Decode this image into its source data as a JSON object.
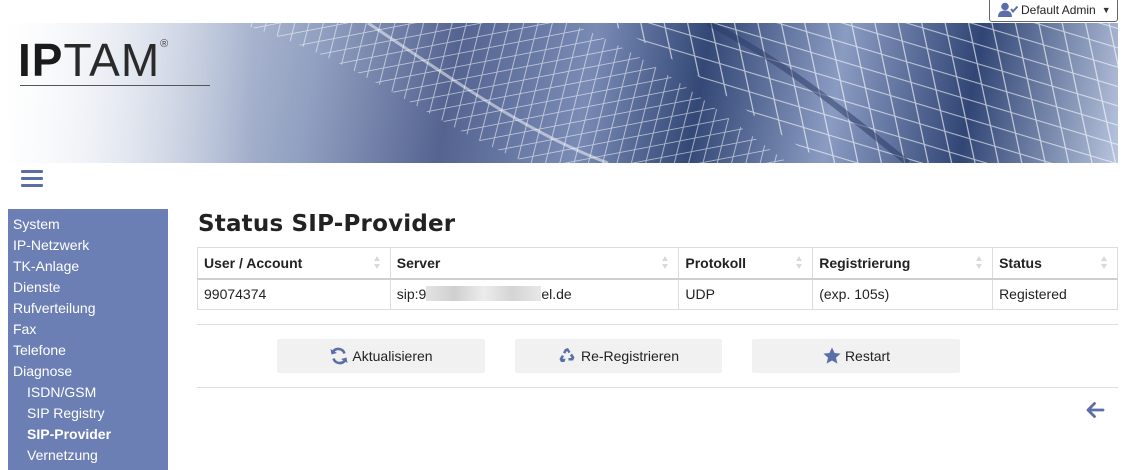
{
  "header": {
    "user_label": "Default Admin",
    "logo": {
      "text_bold": "IP",
      "text_thin": "TAM",
      "registered": "®"
    }
  },
  "sidebar": {
    "items": [
      {
        "label": "System",
        "level": 0
      },
      {
        "label": "IP-Netzwerk",
        "level": 0
      },
      {
        "label": "TK-Anlage",
        "level": 0
      },
      {
        "label": "Dienste",
        "level": 0
      },
      {
        "label": "Rufverteilung",
        "level": 0
      },
      {
        "label": "Fax",
        "level": 0
      },
      {
        "label": "Telefone",
        "level": 0
      },
      {
        "label": "Diagnose",
        "level": 0
      },
      {
        "label": "ISDN/GSM",
        "level": 1
      },
      {
        "label": "SIP Registry",
        "level": 1
      },
      {
        "label": "SIP-Provider",
        "level": 1,
        "active": true
      },
      {
        "label": "Vernetzung",
        "level": 1
      }
    ]
  },
  "main": {
    "title": "Status SIP-Provider",
    "table": {
      "columns": [
        "User / Account",
        "Server",
        "Protokoll",
        "Registrierung",
        "Status"
      ],
      "rows": [
        {
          "account": "99074374",
          "server_prefix": "sip:9",
          "server_suffix": "el.de",
          "protocol": "UDP",
          "registration": "(exp. 105s)",
          "status": "Registered"
        }
      ]
    },
    "buttons": {
      "refresh": "Aktualisieren",
      "reregister": "Re-Registrieren",
      "restart": "Restart"
    }
  },
  "colors": {
    "sidebar_bg": "#6c7fb4",
    "accent": "#5b6ea8",
    "button_bg": "#f1f1f1"
  },
  "icons": {
    "user": "user-check-icon",
    "refresh": "refresh-icon",
    "reregister": "recycle-icon",
    "restart": "star-icon",
    "back": "arrow-left-icon",
    "menu": "hamburger-icon"
  }
}
